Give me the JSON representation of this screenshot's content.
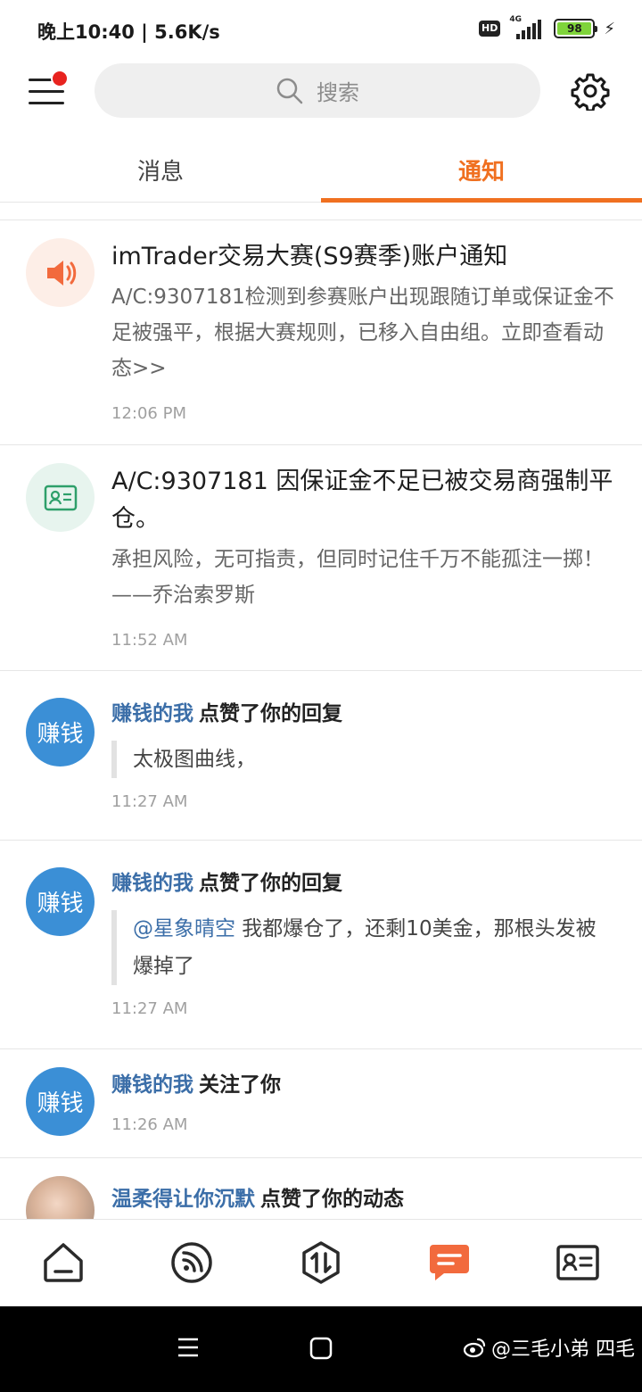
{
  "status_bar": {
    "time_speed": "晚上10:40 | 5.6K/s",
    "hd": "HD",
    "network": "4G",
    "battery": "98"
  },
  "header": {
    "search_placeholder": "搜索",
    "icons": [
      "menu-icon",
      "search-icon",
      "gear-icon"
    ]
  },
  "tabs": [
    {
      "label": "消息",
      "active": false
    },
    {
      "label": "通知",
      "active": true
    }
  ],
  "accent_color": "#f07020",
  "notifications": [
    {
      "type": "system",
      "icon": "speaker-icon",
      "title": "imTrader交易大赛(S9赛季)账户通知",
      "body": "A/C:9307181检测到参赛账户出现跟随订单或保证金不足被强平，根据大赛规则，已移入自由组。立即查看动态>>",
      "time": "12:06 PM"
    },
    {
      "type": "system",
      "icon": "id-card-icon",
      "title": "A/C:9307181 因保证金不足已被交易商强制平仓。",
      "body": "承担风险，无可指责，但同时记住千万不能孤注一掷！——乔治索罗斯",
      "time": "11:52 AM"
    },
    {
      "type": "social",
      "avatar_text": "赚钱",
      "actor": "赚钱的我",
      "action": "点赞了你的回复",
      "quote": "太极图曲线，",
      "time": "11:27 AM"
    },
    {
      "type": "social",
      "avatar_text": "赚钱",
      "actor": "赚钱的我",
      "action": "点赞了你的回复",
      "quote_mention": "@星象晴空",
      "quote": " 我都爆仓了，还剩10美金，那根头发被爆掉了",
      "time": "11:27 AM"
    },
    {
      "type": "social",
      "avatar_text": "赚钱",
      "actor": "赚钱的我",
      "action": "关注了你",
      "time": "11:26 AM"
    },
    {
      "type": "social",
      "avatar": "photo",
      "actor": "温柔得让你沉默",
      "action": "点赞了你的动态"
    }
  ],
  "bottom_nav": [
    {
      "name": "home-icon",
      "active": false
    },
    {
      "name": "feed-icon",
      "active": false
    },
    {
      "name": "trade-icon",
      "active": false
    },
    {
      "name": "message-icon",
      "active": true
    },
    {
      "name": "profile-card-icon",
      "active": false
    }
  ],
  "system_nav": {
    "watermark": "@三毛小弟 四毛"
  }
}
